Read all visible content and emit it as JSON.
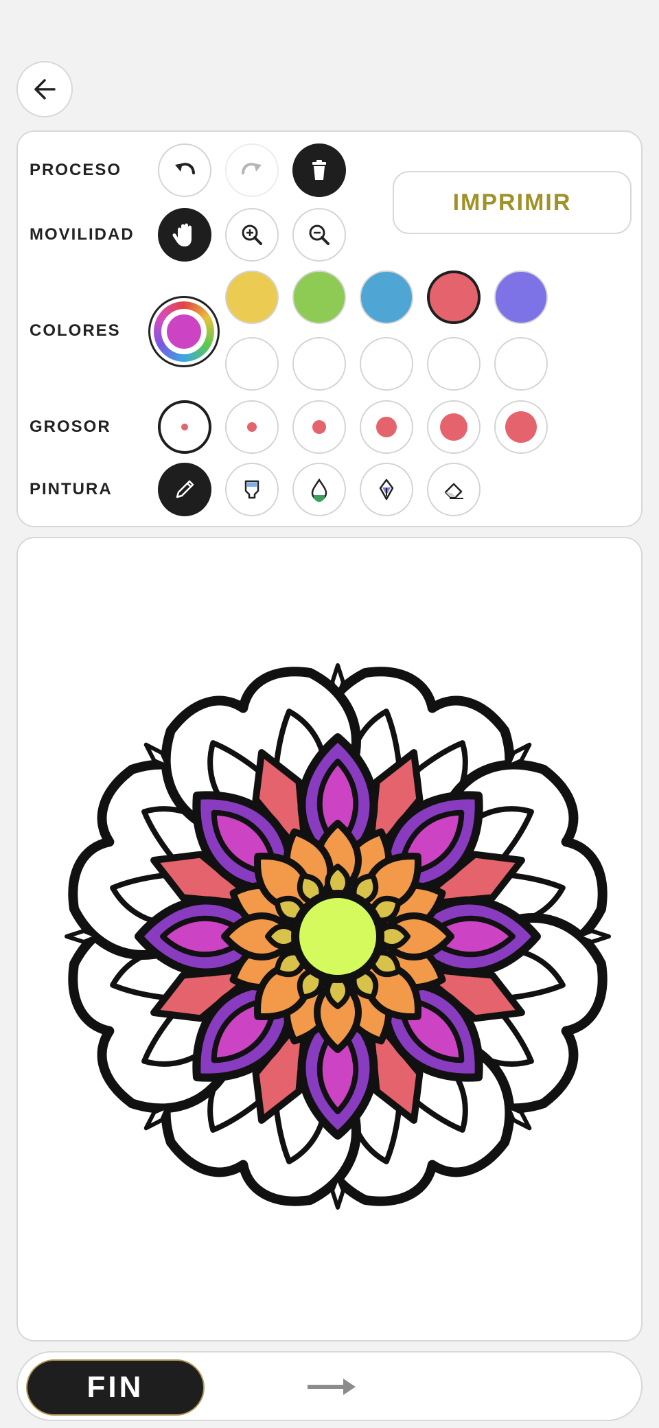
{
  "rows": {
    "proceso": "PROCESO",
    "movilidad": "MOVILIDAD",
    "colores": "COLORES",
    "grosor": "GROSOR",
    "pintura": "PINTURA"
  },
  "print_label": "IMPRIMIR",
  "finish_label": "FIN",
  "colors": {
    "swatches": [
      "#eccb52",
      "#8dcb55",
      "#4fa5d4",
      "#e4636c",
      "#7d72e6"
    ],
    "selected_swatch": "#e4636c",
    "current_color": "#cc44c4",
    "print_text": "#a09128"
  },
  "thickness_levels": 6,
  "icons": {
    "back": "arrow-left-icon",
    "undo": "undo-icon",
    "redo": "redo-icon",
    "delete": "trash-icon",
    "hand": "hand-icon",
    "zoom_in": "zoom-in-icon",
    "zoom_out": "zoom-out-icon",
    "pencil": "pencil-icon",
    "marker": "marker-icon",
    "drop": "drop-icon",
    "pen": "pen-nib-icon",
    "eraser": "eraser-icon",
    "next": "arrow-right-icon"
  }
}
